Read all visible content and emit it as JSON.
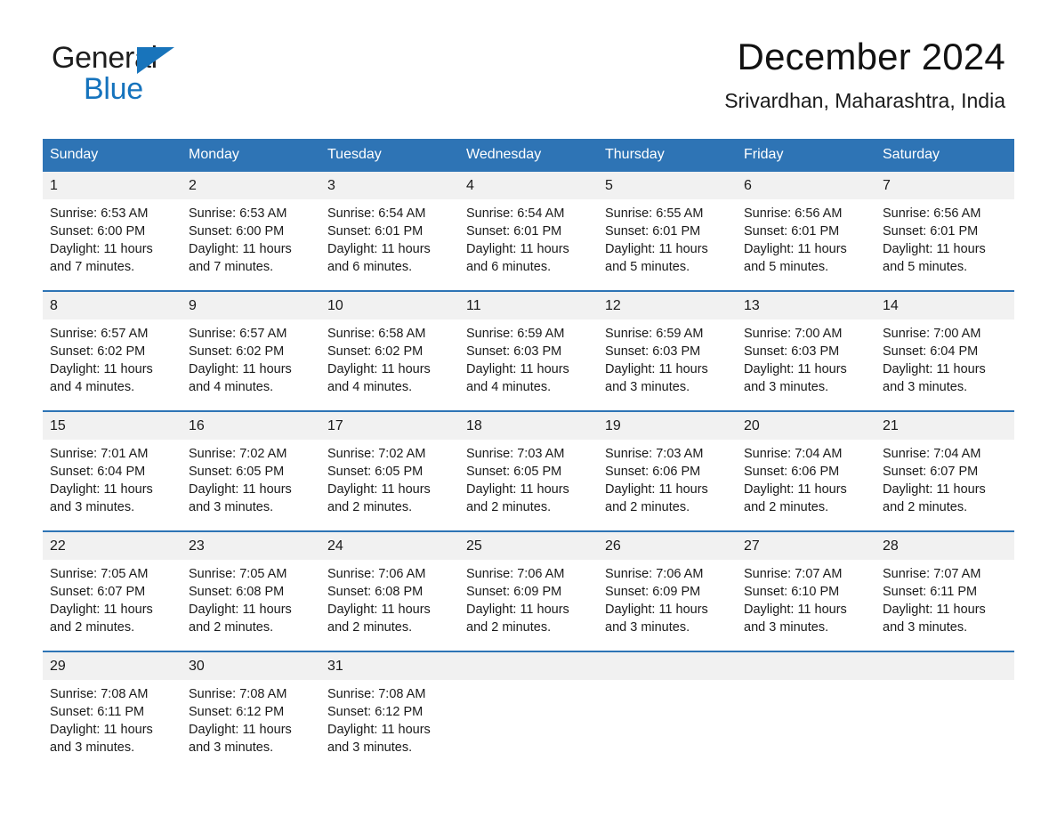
{
  "brand": {
    "name_part1": "General",
    "name_part2": "Blue",
    "triangle_color": "#1874bb",
    "blue_color": "#1573bd"
  },
  "header": {
    "month_title": "December 2024",
    "location": "Srivardhan, Maharashtra, India"
  },
  "theme": {
    "header_blue": "#2e74b5",
    "daynum_background": "#f1f1f1",
    "text_color": "#1a1a1a"
  },
  "calendar": {
    "weekday_headers": [
      "Sunday",
      "Monday",
      "Tuesday",
      "Wednesday",
      "Thursday",
      "Friday",
      "Saturday"
    ],
    "weeks": [
      {
        "days": [
          {
            "date": "1",
            "sunrise": "Sunrise: 6:53 AM",
            "sunset": "Sunset: 6:00 PM",
            "daylight_line1": "Daylight: 11 hours",
            "daylight_line2": "and 7 minutes."
          },
          {
            "date": "2",
            "sunrise": "Sunrise: 6:53 AM",
            "sunset": "Sunset: 6:00 PM",
            "daylight_line1": "Daylight: 11 hours",
            "daylight_line2": "and 7 minutes."
          },
          {
            "date": "3",
            "sunrise": "Sunrise: 6:54 AM",
            "sunset": "Sunset: 6:01 PM",
            "daylight_line1": "Daylight: 11 hours",
            "daylight_line2": "and 6 minutes."
          },
          {
            "date": "4",
            "sunrise": "Sunrise: 6:54 AM",
            "sunset": "Sunset: 6:01 PM",
            "daylight_line1": "Daylight: 11 hours",
            "daylight_line2": "and 6 minutes."
          },
          {
            "date": "5",
            "sunrise": "Sunrise: 6:55 AM",
            "sunset": "Sunset: 6:01 PM",
            "daylight_line1": "Daylight: 11 hours",
            "daylight_line2": "and 5 minutes."
          },
          {
            "date": "6",
            "sunrise": "Sunrise: 6:56 AM",
            "sunset": "Sunset: 6:01 PM",
            "daylight_line1": "Daylight: 11 hours",
            "daylight_line2": "and 5 minutes."
          },
          {
            "date": "7",
            "sunrise": "Sunrise: 6:56 AM",
            "sunset": "Sunset: 6:01 PM",
            "daylight_line1": "Daylight: 11 hours",
            "daylight_line2": "and 5 minutes."
          }
        ]
      },
      {
        "days": [
          {
            "date": "8",
            "sunrise": "Sunrise: 6:57 AM",
            "sunset": "Sunset: 6:02 PM",
            "daylight_line1": "Daylight: 11 hours",
            "daylight_line2": "and 4 minutes."
          },
          {
            "date": "9",
            "sunrise": "Sunrise: 6:57 AM",
            "sunset": "Sunset: 6:02 PM",
            "daylight_line1": "Daylight: 11 hours",
            "daylight_line2": "and 4 minutes."
          },
          {
            "date": "10",
            "sunrise": "Sunrise: 6:58 AM",
            "sunset": "Sunset: 6:02 PM",
            "daylight_line1": "Daylight: 11 hours",
            "daylight_line2": "and 4 minutes."
          },
          {
            "date": "11",
            "sunrise": "Sunrise: 6:59 AM",
            "sunset": "Sunset: 6:03 PM",
            "daylight_line1": "Daylight: 11 hours",
            "daylight_line2": "and 4 minutes."
          },
          {
            "date": "12",
            "sunrise": "Sunrise: 6:59 AM",
            "sunset": "Sunset: 6:03 PM",
            "daylight_line1": "Daylight: 11 hours",
            "daylight_line2": "and 3 minutes."
          },
          {
            "date": "13",
            "sunrise": "Sunrise: 7:00 AM",
            "sunset": "Sunset: 6:03 PM",
            "daylight_line1": "Daylight: 11 hours",
            "daylight_line2": "and 3 minutes."
          },
          {
            "date": "14",
            "sunrise": "Sunrise: 7:00 AM",
            "sunset": "Sunset: 6:04 PM",
            "daylight_line1": "Daylight: 11 hours",
            "daylight_line2": "and 3 minutes."
          }
        ]
      },
      {
        "days": [
          {
            "date": "15",
            "sunrise": "Sunrise: 7:01 AM",
            "sunset": "Sunset: 6:04 PM",
            "daylight_line1": "Daylight: 11 hours",
            "daylight_line2": "and 3 minutes."
          },
          {
            "date": "16",
            "sunrise": "Sunrise: 7:02 AM",
            "sunset": "Sunset: 6:05 PM",
            "daylight_line1": "Daylight: 11 hours",
            "daylight_line2": "and 3 minutes."
          },
          {
            "date": "17",
            "sunrise": "Sunrise: 7:02 AM",
            "sunset": "Sunset: 6:05 PM",
            "daylight_line1": "Daylight: 11 hours",
            "daylight_line2": "and 2 minutes."
          },
          {
            "date": "18",
            "sunrise": "Sunrise: 7:03 AM",
            "sunset": "Sunset: 6:05 PM",
            "daylight_line1": "Daylight: 11 hours",
            "daylight_line2": "and 2 minutes."
          },
          {
            "date": "19",
            "sunrise": "Sunrise: 7:03 AM",
            "sunset": "Sunset: 6:06 PM",
            "daylight_line1": "Daylight: 11 hours",
            "daylight_line2": "and 2 minutes."
          },
          {
            "date": "20",
            "sunrise": "Sunrise: 7:04 AM",
            "sunset": "Sunset: 6:06 PM",
            "daylight_line1": "Daylight: 11 hours",
            "daylight_line2": "and 2 minutes."
          },
          {
            "date": "21",
            "sunrise": "Sunrise: 7:04 AM",
            "sunset": "Sunset: 6:07 PM",
            "daylight_line1": "Daylight: 11 hours",
            "daylight_line2": "and 2 minutes."
          }
        ]
      },
      {
        "days": [
          {
            "date": "22",
            "sunrise": "Sunrise: 7:05 AM",
            "sunset": "Sunset: 6:07 PM",
            "daylight_line1": "Daylight: 11 hours",
            "daylight_line2": "and 2 minutes."
          },
          {
            "date": "23",
            "sunrise": "Sunrise: 7:05 AM",
            "sunset": "Sunset: 6:08 PM",
            "daylight_line1": "Daylight: 11 hours",
            "daylight_line2": "and 2 minutes."
          },
          {
            "date": "24",
            "sunrise": "Sunrise: 7:06 AM",
            "sunset": "Sunset: 6:08 PM",
            "daylight_line1": "Daylight: 11 hours",
            "daylight_line2": "and 2 minutes."
          },
          {
            "date": "25",
            "sunrise": "Sunrise: 7:06 AM",
            "sunset": "Sunset: 6:09 PM",
            "daylight_line1": "Daylight: 11 hours",
            "daylight_line2": "and 2 minutes."
          },
          {
            "date": "26",
            "sunrise": "Sunrise: 7:06 AM",
            "sunset": "Sunset: 6:09 PM",
            "daylight_line1": "Daylight: 11 hours",
            "daylight_line2": "and 3 minutes."
          },
          {
            "date": "27",
            "sunrise": "Sunrise: 7:07 AM",
            "sunset": "Sunset: 6:10 PM",
            "daylight_line1": "Daylight: 11 hours",
            "daylight_line2": "and 3 minutes."
          },
          {
            "date": "28",
            "sunrise": "Sunrise: 7:07 AM",
            "sunset": "Sunset: 6:11 PM",
            "daylight_line1": "Daylight: 11 hours",
            "daylight_line2": "and 3 minutes."
          }
        ]
      },
      {
        "days": [
          {
            "date": "29",
            "sunrise": "Sunrise: 7:08 AM",
            "sunset": "Sunset: 6:11 PM",
            "daylight_line1": "Daylight: 11 hours",
            "daylight_line2": "and 3 minutes."
          },
          {
            "date": "30",
            "sunrise": "Sunrise: 7:08 AM",
            "sunset": "Sunset: 6:12 PM",
            "daylight_line1": "Daylight: 11 hours",
            "daylight_line2": "and 3 minutes."
          },
          {
            "date": "31",
            "sunrise": "Sunrise: 7:08 AM",
            "sunset": "Sunset: 6:12 PM",
            "daylight_line1": "Daylight: 11 hours",
            "daylight_line2": "and 3 minutes."
          },
          {
            "date": "",
            "sunrise": "",
            "sunset": "",
            "daylight_line1": "",
            "daylight_line2": ""
          },
          {
            "date": "",
            "sunrise": "",
            "sunset": "",
            "daylight_line1": "",
            "daylight_line2": ""
          },
          {
            "date": "",
            "sunrise": "",
            "sunset": "",
            "daylight_line1": "",
            "daylight_line2": ""
          },
          {
            "date": "",
            "sunrise": "",
            "sunset": "",
            "daylight_line1": "",
            "daylight_line2": ""
          }
        ]
      }
    ]
  }
}
